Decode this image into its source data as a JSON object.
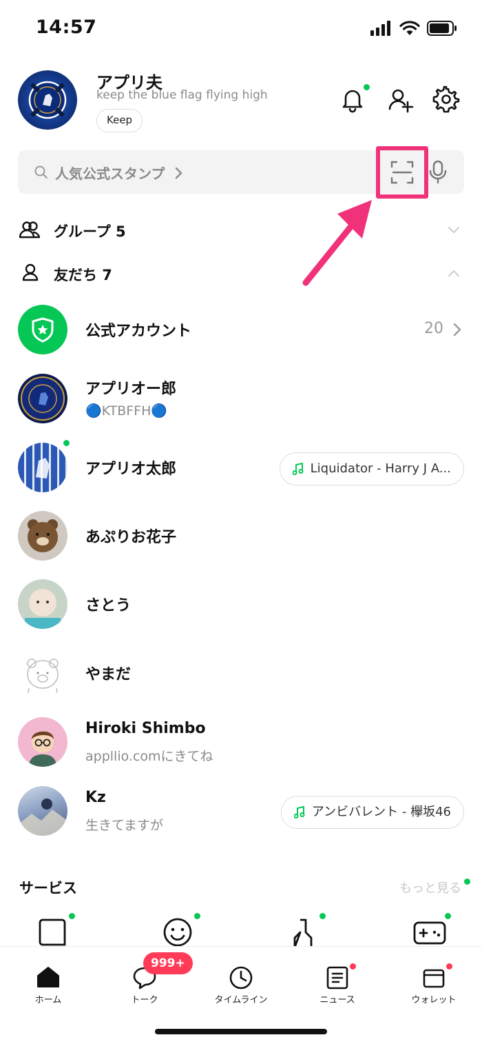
{
  "status_bar": {
    "time": "14:57"
  },
  "profile": {
    "name": "アプリ夫",
    "status_message": "keep the blue flag flying high",
    "keep_label": "Keep"
  },
  "search": {
    "placeholder": "人気公式スタンプ",
    "chevron": ">"
  },
  "sections": {
    "groups": {
      "label": "グループ 5"
    },
    "friends": {
      "label": "友だち 7"
    }
  },
  "official_account": {
    "label": "公式アカウント",
    "count": "20"
  },
  "friends": [
    {
      "name": "アプリオー郎",
      "sub": "🔵KTBFFH🔵",
      "music": ""
    },
    {
      "name": "アプリオ太郎",
      "sub": "",
      "music": "Liquidator - Harry J A..."
    },
    {
      "name": "あぷりお花子",
      "sub": "",
      "music": ""
    },
    {
      "name": "さとう",
      "sub": "",
      "music": ""
    },
    {
      "name": "やまだ",
      "sub": "",
      "music": ""
    },
    {
      "name": "Hiroki Shimbo",
      "sub": "appllio.comにきてね",
      "music": ""
    },
    {
      "name": "Kz",
      "sub": "生きてますが",
      "music": "アンビバレント - 欅坂46"
    }
  ],
  "services": {
    "title": "サービス",
    "more": "もっと見る"
  },
  "tabbar": {
    "tabs": [
      {
        "label": "ホーム"
      },
      {
        "label": "トーク"
      },
      {
        "label": "タイムライン"
      },
      {
        "label": "ニュース"
      },
      {
        "label": "ウォレット"
      }
    ],
    "talk_badge": "999+"
  },
  "colors": {
    "accent_green": "#06c755",
    "badge_red": "#ff3b58",
    "highlight_pink": "#f0327a"
  }
}
